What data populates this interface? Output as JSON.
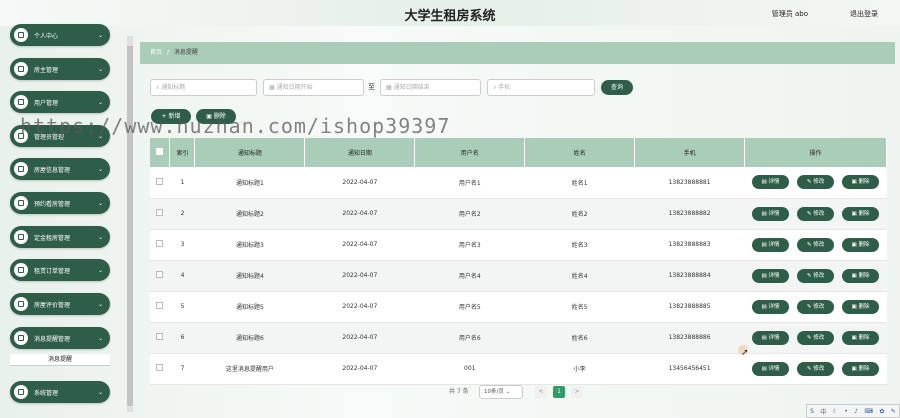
{
  "header": {
    "title": "大学生租房系统",
    "user_label": "管理员 abo",
    "logout_label": "退出登录"
  },
  "sidebar": {
    "items": [
      {
        "label": "个人中心"
      },
      {
        "label": "房主管理"
      },
      {
        "label": "用户管理"
      },
      {
        "label": "管理员管理"
      },
      {
        "label": "房屋信息管理"
      },
      {
        "label": "预约看房管理"
      },
      {
        "label": "定金租房管理"
      },
      {
        "label": "租赁订单管理"
      },
      {
        "label": "房屋评价管理"
      },
      {
        "label": "消息提醒管理"
      },
      {
        "label": "系统管理"
      }
    ],
    "active_sub": "消息提醒"
  },
  "breadcrumb": {
    "home": "首页",
    "sep": "/",
    "current": "消息提醒"
  },
  "search": {
    "title_placeholder": "通知标题",
    "date_start_placeholder": "通知日期开始",
    "to_label": "至",
    "date_end_placeholder": "通知日期结束",
    "phone_placeholder": "手机",
    "query_label": "查询"
  },
  "toolbar": {
    "add_label": "+ 新增",
    "delete_label": "删除"
  },
  "table": {
    "headers": [
      "索引",
      "通知标题",
      "通知日期",
      "用户名",
      "姓名",
      "手机",
      "操作"
    ],
    "rows": [
      {
        "idx": "1",
        "title": "通知标题1",
        "date": "2022-04-07",
        "username": "用户名1",
        "name": "姓名1",
        "phone": "13823888881"
      },
      {
        "idx": "2",
        "title": "通知标题2",
        "date": "2022-04-07",
        "username": "用户名2",
        "name": "姓名2",
        "phone": "13823888882"
      },
      {
        "idx": "3",
        "title": "通知标题3",
        "date": "2022-04-07",
        "username": "用户名3",
        "name": "姓名3",
        "phone": "13823888883"
      },
      {
        "idx": "4",
        "title": "通知标题4",
        "date": "2022-04-07",
        "username": "用户名4",
        "name": "姓名4",
        "phone": "13823888884"
      },
      {
        "idx": "5",
        "title": "通知标题5",
        "date": "2022-04-07",
        "username": "用户名5",
        "name": "姓名5",
        "phone": "13823888885"
      },
      {
        "idx": "6",
        "title": "通知标题6",
        "date": "2022-04-07",
        "username": "用户名6",
        "name": "姓名6",
        "phone": "13823888886"
      },
      {
        "idx": "7",
        "title": "这里消息提醒用户",
        "date": "2022-04-07",
        "username": "001",
        "name": "小李",
        "phone": "13456456451"
      }
    ],
    "actions": {
      "detail": "详情",
      "edit": "修改",
      "delete": "删除"
    }
  },
  "pagination": {
    "total_label": "共 7 条",
    "page_size": "10条/页",
    "current_page": "1",
    "prev": "<",
    "next": ">"
  },
  "watermark": "https://www.huzhan.com/ishop39397",
  "colors": {
    "primary": "#2f5e48",
    "header_green": "#a9cdb9",
    "page_active": "#2f9b6a"
  }
}
